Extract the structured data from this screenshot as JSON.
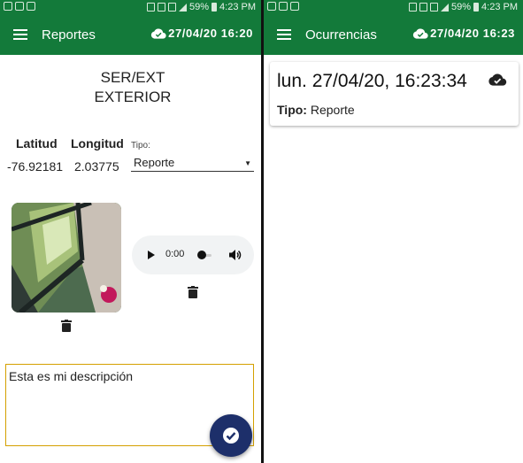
{
  "left_panel": {
    "status_bar": {
      "battery": "59%",
      "time": "4:23 PM"
    },
    "toolbar": {
      "title": "Reportes",
      "sync_time": "27/04/20 16:20",
      "menu_icon": "menu-icon",
      "sync_icon": "cloud-done-icon"
    },
    "heading": {
      "line1": "SER/EXT",
      "line2": "EXTERIOR"
    },
    "coords": {
      "latitud_label": "Latitud",
      "longitud_label": "Longitud",
      "latitud": "-76.92181",
      "longitud": "2.03775"
    },
    "tipo": {
      "label": "Tipo:",
      "value": "Reporte"
    },
    "audio": {
      "time": "0:00",
      "progress": 0
    },
    "description": "Esta es mi descripción",
    "colors": {
      "appbar": "#137a3a",
      "fab": "#1d2f6a",
      "field_border": "#d4a000"
    }
  },
  "right_panel": {
    "status_bar": {
      "battery": "59%",
      "time": "4:23 PM"
    },
    "toolbar": {
      "title": "Ocurrencias",
      "sync_time": "27/04/20 16:23",
      "menu_icon": "menu-icon",
      "sync_icon": "cloud-done-icon"
    },
    "card": {
      "title": "lun. 27/04/20, 16:23:34",
      "tipo_label": "Tipo:",
      "tipo_value": "Reporte"
    }
  }
}
